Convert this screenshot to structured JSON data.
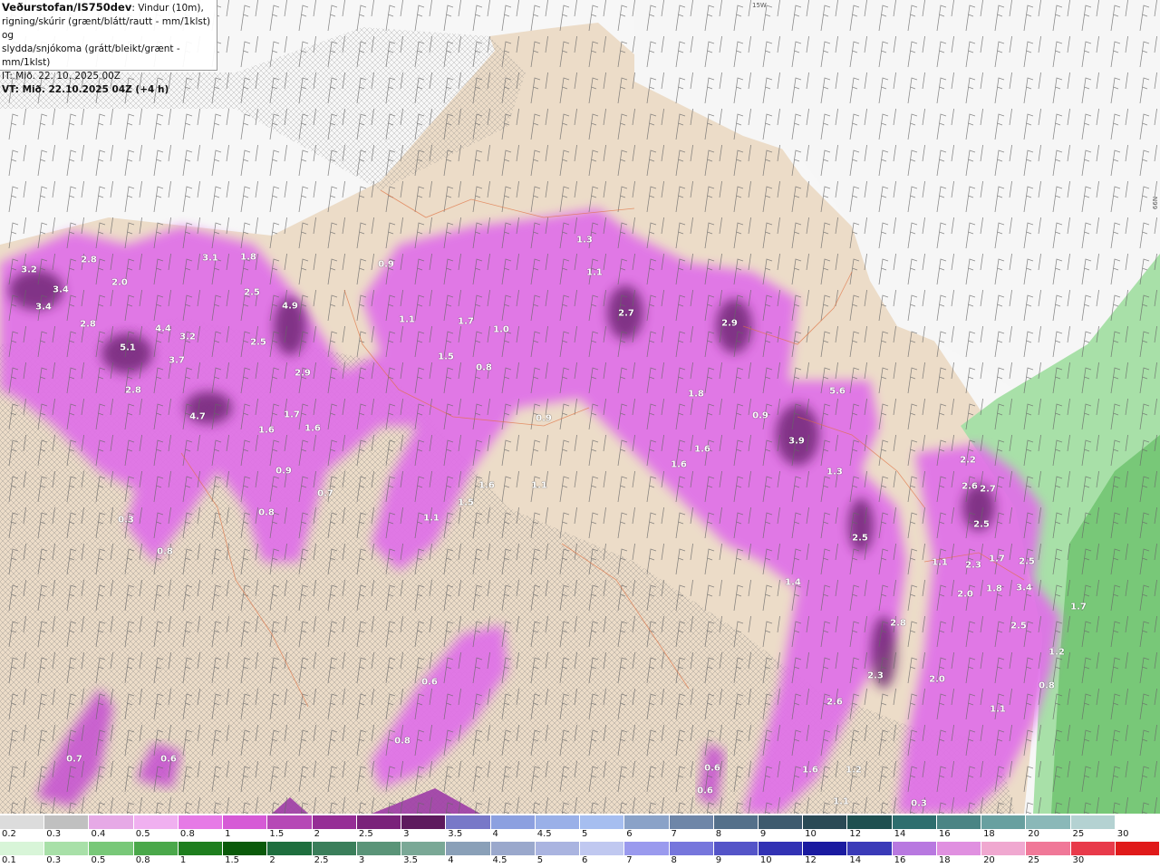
{
  "title": {
    "agency": "Veðurstofan/IS750dev",
    "line1_rest": ": Vindur (10m),",
    "line2": "rigning/skúrir (grænt/blátt/rautt - mm/1klst) og",
    "line3": "slydda/snjókoma (grátt/bleikt/grænt - mm/1klst)",
    "it": "IT: Mið. 22. 10. 2025 00Z",
    "vt": "VT: Mið. 22.10.2025 04Z (+4 h)"
  },
  "grid_labels": {
    "top": "15W",
    "right": "66N"
  },
  "values": [
    "3.2",
    "2.8",
    "3.4",
    "3.4",
    "2.0",
    "2.8",
    "5.1",
    "4.4",
    "3.2",
    "3.7",
    "2.8",
    "4.7",
    "3.1",
    "1.8",
    "2.5",
    "4.9",
    "2.5",
    "2.9",
    "1.7",
    "1.6",
    "1.6",
    "0.9",
    "0.7",
    "0.8",
    "0.3",
    "0.8",
    "0.9",
    "1.1",
    "1.7",
    "1.0",
    "1.5",
    "0.8",
    "0.9",
    "1.3",
    "1.1",
    "2.7",
    "2.9",
    "1.8",
    "1.6",
    "1.6",
    "0.9",
    "1.6",
    "1.1",
    "1.5",
    "1.1",
    "5.6",
    "3.9",
    "1.3",
    "2.5",
    "1.4",
    "2.2",
    "2.6",
    "2.7",
    "2.5",
    "1.1",
    "2.3",
    "1.7",
    "2.5",
    "2.0",
    "1.8",
    "3.4",
    "2.5",
    "2.8",
    "2.3",
    "2.6",
    "2.0",
    "1.1",
    "1.6",
    "1.2",
    "1.1",
    "0.3",
    "0.6",
    "0.8",
    "0.6",
    "0.6",
    "0.7",
    "0.6",
    "0.8",
    "1.7",
    "1.2",
    "0.2"
  ],
  "legend_snow": {
    "ticks": [
      "0.2",
      "0.3",
      "0.4",
      "0.5",
      "0.8",
      "1",
      "1.5",
      "2",
      "2.5",
      "3",
      "3.5",
      "4",
      "4.5",
      "5",
      "6",
      "7",
      "8",
      "9",
      "10",
      "12",
      "14",
      "16",
      "18",
      "20",
      "25",
      "30"
    ],
    "colors": [
      "#dcdcdc",
      "#c0c0c0",
      "#e6a9e6",
      "#f0b0f0",
      "#e67ae6",
      "#d65ad6",
      "#b648b6",
      "#962e96",
      "#7a227a",
      "#5e1a5e",
      "#7878c8",
      "#8ca0e0",
      "#9ab0e8",
      "#a6bef0",
      "#8aa2c8",
      "#6e86a8",
      "#54708a",
      "#3e5a6e",
      "#2a4a55",
      "#1e5050",
      "#2e6e6e",
      "#4a8484",
      "#68a0a0",
      "#8ab8b8",
      "#b4d2d2",
      "#ffffff"
    ]
  },
  "legend_rain": {
    "ticks": [
      "0.1",
      "0.3",
      "0.5",
      "0.8",
      "1",
      "1.5",
      "2",
      "2.5",
      "3",
      "3.5",
      "4",
      "4.5",
      "5",
      "6",
      "7",
      "8",
      "9",
      "10",
      "12",
      "14",
      "16",
      "18",
      "20",
      "25",
      "30"
    ],
    "colors": [
      "#d8f5d8",
      "#a8e0a8",
      "#78c878",
      "#4aa84a",
      "#1e7e1e",
      "#0a5a0a",
      "#1e6e3e",
      "#3a7e5a",
      "#5a9478",
      "#7aa896",
      "#8aa0b8",
      "#9aa8cc",
      "#aab4e0",
      "#c0c8f0",
      "#9a9aee",
      "#7676dc",
      "#5454c8",
      "#3232b4",
      "#1a1aa0",
      "#3a3ab8",
      "#b878e0",
      "#e090e0",
      "#f0a8d0",
      "#f07898",
      "#e83a4a",
      "#e01a1a"
    ]
  },
  "colors": {
    "land": "#ecdcc8",
    "wind_barb": "#555555",
    "border": "#e07040"
  }
}
